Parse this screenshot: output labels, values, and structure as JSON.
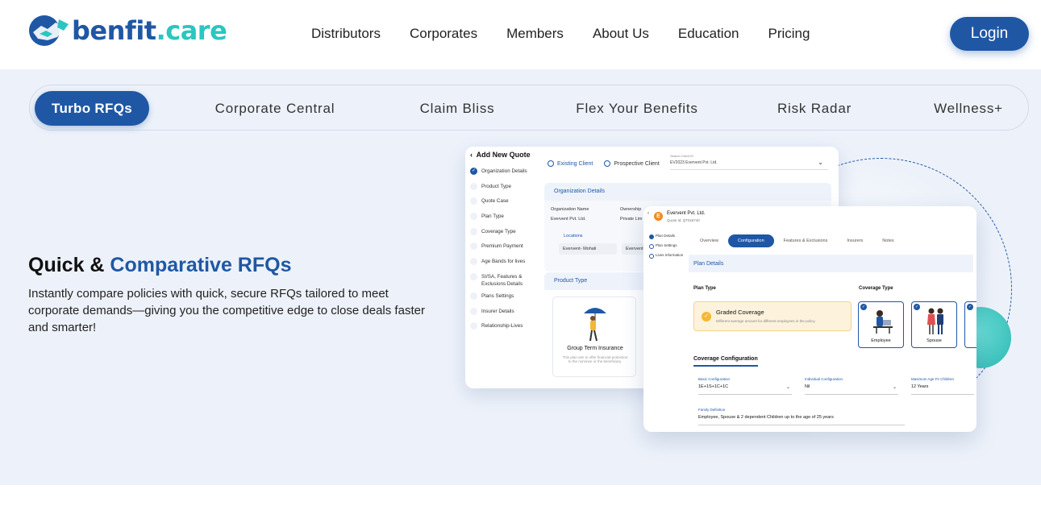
{
  "brand": {
    "logo_text_main": "benfit",
    "logo_text_dot": ".",
    "logo_text_care": "care",
    "colors": {
      "primary": "#1f57a5",
      "accent": "#2bc6c0",
      "section_bg": "#edf2fa"
    }
  },
  "nav": {
    "items": [
      "Distributors",
      "Corporates",
      "Members",
      "About Us",
      "Education",
      "Pricing"
    ],
    "login_label": "Login"
  },
  "tabs": {
    "active": "Turbo RFQs",
    "items": [
      "Corporate Central",
      "Claim Bliss",
      "Flex Your Benefits",
      "Risk Radar",
      "Wellness+"
    ]
  },
  "hero": {
    "title_plain": "Quick & ",
    "title_accent": "Comparative RFQs",
    "description": "Instantly compare policies with quick, secure RFQs tailored to meet corporate demands—giving you the competitive edge to close deals faster and smarter!"
  },
  "card1": {
    "title": "Add New Quote",
    "steps": [
      "Organization Details",
      "Product Type",
      "Quote Case",
      "Plan Type",
      "Coverage Type",
      "Premium Payment",
      "Age Bands for lives",
      "SI/SA, Features & Exclusions Details",
      "Plans Settings",
      "Insurer Details",
      "Relationship-Lives"
    ],
    "radio_existing": "Existing Client",
    "radio_prospective": "Prospective Client",
    "search_label": "Search Client ID",
    "search_value": "EV2023 Evervent Pvt. Ltd.",
    "org_header": "Organization Details",
    "org_name_label": "Organization Name",
    "org_name_value": "Evervent Pvt. Ltd.",
    "ownership_label": "Ownership",
    "ownership_value": "Private Lim",
    "locations_label": "Locations",
    "location_1": "Evervent- Mohali",
    "location_2": "Evervent",
    "product_header": "Product Type",
    "product_title": "Group Term Insurance",
    "product_desc": "This plan aim to offer financial protection to the nominee or the beneficiary."
  },
  "card2": {
    "avatar_letter": "E",
    "company": "Evervent Pvt. Ltd.",
    "quote_id": "Quote Id: QT0x6740",
    "side_steps": [
      "Plan Details",
      "Plan Settings",
      "Lives Information"
    ],
    "tabs": [
      "Overview",
      "Configuration",
      "Features & Exclusions",
      "Insurers",
      "Notes"
    ],
    "active_tab": "Configuration",
    "plan_details_header": "Plan Details",
    "plan_type_label": "Plan Type",
    "coverage_type_label": "Coverage Type",
    "graded_title": "Graded Coverage",
    "graded_desc": "Different average amount for different employees in the policy.",
    "coverage_cards": [
      "Employee",
      "Spouse"
    ],
    "coverage_config_label": "Coverage Configuration",
    "basic_config_label": "Basic Configuration",
    "basic_config_value": "1E+1S+1C+1C",
    "individual_config_label": "Individual Configuration",
    "individual_config_value": "Nil",
    "max_age_label": "Maximum Age Fir Children",
    "max_age_value": "12 Years",
    "family_def_label": "Family Definition",
    "family_def_value": "Employee, Spouse & 2 dependent Children up to the age of 25 years"
  }
}
